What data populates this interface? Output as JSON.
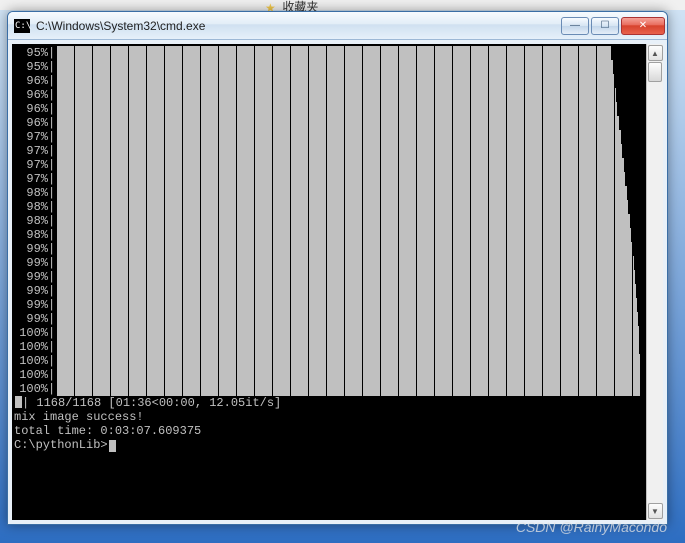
{
  "browser_hint": {
    "bookmark_label": "收藏夹"
  },
  "window": {
    "title": "C:\\Windows\\System32\\cmd.exe",
    "buttons": {
      "minimize": "min",
      "maximize": "max",
      "close": "close"
    }
  },
  "progress": {
    "rows": [
      {
        "pct": "95%",
        "fill": 95.0
      },
      {
        "pct": "95%",
        "fill": 95.3
      },
      {
        "pct": "96%",
        "fill": 95.6
      },
      {
        "pct": "96%",
        "fill": 95.8
      },
      {
        "pct": "96%",
        "fill": 96.1
      },
      {
        "pct": "96%",
        "fill": 96.4
      },
      {
        "pct": "97%",
        "fill": 96.7
      },
      {
        "pct": "97%",
        "fill": 96.9
      },
      {
        "pct": "97%",
        "fill": 97.2
      },
      {
        "pct": "97%",
        "fill": 97.5
      },
      {
        "pct": "98%",
        "fill": 97.8
      },
      {
        "pct": "98%",
        "fill": 98.0
      },
      {
        "pct": "98%",
        "fill": 98.3
      },
      {
        "pct": "98%",
        "fill": 98.5
      },
      {
        "pct": "99%",
        "fill": 98.7
      },
      {
        "pct": "99%",
        "fill": 98.9
      },
      {
        "pct": "99%",
        "fill": 99.1
      },
      {
        "pct": "99%",
        "fill": 99.3
      },
      {
        "pct": "99%",
        "fill": 99.5
      },
      {
        "pct": "99%",
        "fill": 99.7
      },
      {
        "pct": "100%",
        "fill": 99.8
      },
      {
        "pct": "100%",
        "fill": 99.9
      },
      {
        "pct": "100%",
        "fill": 99.95
      },
      {
        "pct": "100%",
        "fill": 100.0
      },
      {
        "pct": "100%",
        "fill": 100.0
      }
    ]
  },
  "final": {
    "counter_line": "| 1168/1168 [01:36<00:00, 12.05it/s]",
    "success_line": "mix image success!",
    "time_line": "total time: 0:03:07.609375",
    "blank": "",
    "prompt": "C:\\pythonLib>"
  },
  "watermark": "CSDN @RainyMacondo"
}
